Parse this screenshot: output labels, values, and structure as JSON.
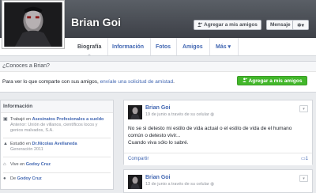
{
  "profile": {
    "name": "Brian Goi"
  },
  "header_buttons": {
    "add_friend": "Agregar a mis amigos",
    "message": "Mensaje",
    "add_friend_icon": "add-friend-icon",
    "gear_icon": "gear-icon",
    "caret": "▾"
  },
  "tabs": [
    {
      "label": "Biografía",
      "active": true
    },
    {
      "label": "Información"
    },
    {
      "label": "Fotos"
    },
    {
      "label": "Amigos"
    },
    {
      "label": "Más ▾"
    }
  ],
  "know_box": {
    "title": "¿Conoces a Brian?",
    "text_before": "Para ver lo que comparte con sus amigos, ",
    "link": "envíale una solicitud de amistad",
    "text_after": ".",
    "button": "Agregar a mis amigos"
  },
  "info": {
    "title": "Información",
    "work": {
      "prefix": "Trabajó en ",
      "link": "Asesinatos Profesionales a sueldo",
      "sub": "Anterior: Unión de villanos, científicos locos y genios malvados, S.A."
    },
    "study": {
      "prefix": "Estudió en ",
      "link": "Dr.Nicolas Avellaneda",
      "sub": "Generación 2011"
    },
    "lives": {
      "prefix": "Vive en ",
      "link": "Godoy Cruz"
    },
    "from": {
      "prefix": "De ",
      "link": "Godoy Cruz"
    }
  },
  "posts": [
    {
      "author": "Brian Goi",
      "meta": "19 de junio a través de su celular",
      "text_line1": "No se si detesto mi estilo de vida actual o el estilo de vida de el humano",
      "text_line2": "común o detesto vivir...",
      "text_line3": "Cuando viva sólo lo sabré.",
      "share": "Compartir",
      "comment_count": "1"
    },
    {
      "author": "Brian Goi",
      "meta": "13 de junio a través de su celular"
    }
  ],
  "colors": {
    "link": "#4267b2",
    "green": "#42b72a",
    "cover": "#4b4f56"
  }
}
